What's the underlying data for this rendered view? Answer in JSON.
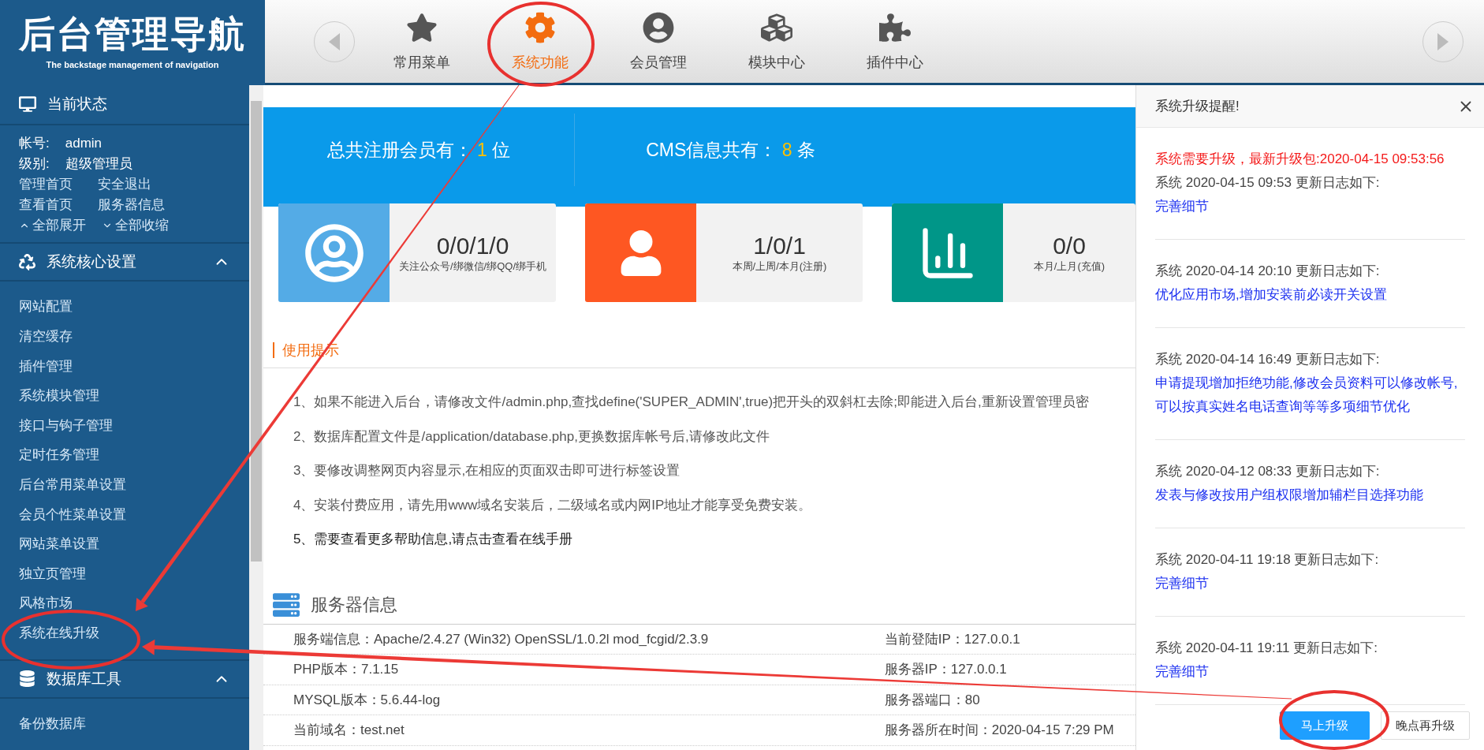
{
  "header": {
    "logo_title": "后台管理导航",
    "logo_subtitle": "The backstage management of navigation",
    "nav": [
      {
        "label": "常用菜单",
        "selected": false
      },
      {
        "label": "系统功能",
        "selected": true
      },
      {
        "label": "会员管理",
        "selected": false
      },
      {
        "label": "模块中心",
        "selected": false
      },
      {
        "label": "插件中心",
        "selected": false
      }
    ]
  },
  "sidebar": {
    "status_title": "当前状态",
    "account": [
      {
        "label": "帐号:",
        "value": "admin"
      },
      {
        "label": "级别:",
        "value": "超级管理员"
      }
    ],
    "links": [
      [
        "管理首页",
        "安全退出"
      ],
      [
        "查看首页",
        "服务器信息"
      ]
    ],
    "expand_all": "全部展开",
    "collapse_all": "全部收缩",
    "groups": [
      {
        "title": "系统核心设置",
        "expanded": true,
        "items": [
          "网站配置",
          "清空缓存",
          "插件管理",
          "系统模块管理",
          "接口与钩子管理",
          "定时任务管理",
          "后台常用菜单设置",
          "会员个性菜单设置",
          "网站菜单设置",
          "独立页管理",
          "风格市场",
          "系统在线升级"
        ]
      },
      {
        "title": "数据库工具",
        "expanded": true,
        "items": [
          "备份数据库"
        ]
      }
    ]
  },
  "stats": [
    {
      "label": "总共注册会员有：",
      "value": "1",
      "unit": "位"
    },
    {
      "label": "CMS信息共有：",
      "value": "8",
      "unit": "条"
    }
  ],
  "cards": [
    {
      "value": "0/0/1/0",
      "caption": "关注公众号/绑微信/绑QQ/绑手机",
      "color": "#54abe6"
    },
    {
      "value": "1/0/1",
      "caption": "本周/上周/本月(注册)",
      "color": "#fe5722"
    },
    {
      "value": "0/0",
      "caption": "本月/上月(充值)",
      "color": "#009688"
    }
  ],
  "tips": {
    "title": "使用提示",
    "items": [
      {
        "kind": "text",
        "text": "1、如果不能进入后台，请修改文件/admin.php,查找define('SUPER_ADMIN',true)把开头的双斜杠去除;即能进入后台,重新设置管理员密"
      },
      {
        "kind": "text",
        "text": "2、数据库配置文件是/application/database.php,更换数据库帐号后,请修改此文件"
      },
      {
        "kind": "text",
        "text": "3、要修改调整网页内容显示,在相应的页面双击即可进行标签设置"
      },
      {
        "kind": "text",
        "text": "4、安装付费应用，请先用www域名安装后，二级域名或内网IP地址才能享受免费安装。"
      },
      {
        "kind": "link",
        "text": "5、需要查看更多帮助信息,请点击查看在线手册"
      }
    ]
  },
  "server": {
    "title": "服务器信息",
    "rows": [
      [
        "服务端信息：Apache/2.4.27 (Win32) OpenSSL/1.0.2l mod_fcgid/2.3.9",
        "当前登陆IP：127.0.0.1"
      ],
      [
        "PHP版本：7.1.15",
        "服务器IP：127.0.0.1"
      ],
      [
        "MYSQL版本：5.6.44-log",
        "服务器端口：80"
      ],
      [
        "当前域名：test.net",
        "服务器所在时间：2020-04-15 7:29 PM"
      ]
    ]
  },
  "panel": {
    "title": "系统升级提醒!",
    "alert": "系统需要升级，最新升级包:2020-04-15 09:53:56",
    "entries": [
      {
        "heading": "系统 2020-04-15 09:53 更新日志如下:",
        "note": "完善细节"
      },
      {
        "heading": "系统 2020-04-14 20:10 更新日志如下:",
        "note": "优化应用市场,增加安装前必读开关设置"
      },
      {
        "heading": "系统 2020-04-14 16:49 更新日志如下:",
        "note": "申请提现增加拒绝功能,修改会员资料可以修改帐号,可以按真实姓名电话查询等等多项细节优化"
      },
      {
        "heading": "系统 2020-04-12 08:33 更新日志如下:",
        "note": "发表与修改按用户组权限增加辅栏目选择功能"
      },
      {
        "heading": "系统 2020-04-11 19:18 更新日志如下:",
        "note": "完善细节"
      },
      {
        "heading": "系统 2020-04-11 19:11 更新日志如下:",
        "note": "完善细节"
      }
    ],
    "buttons": [
      {
        "kind": "primary",
        "label": "马上升级"
      },
      {
        "kind": "secondary",
        "label": "晚点再升级"
      }
    ]
  }
}
